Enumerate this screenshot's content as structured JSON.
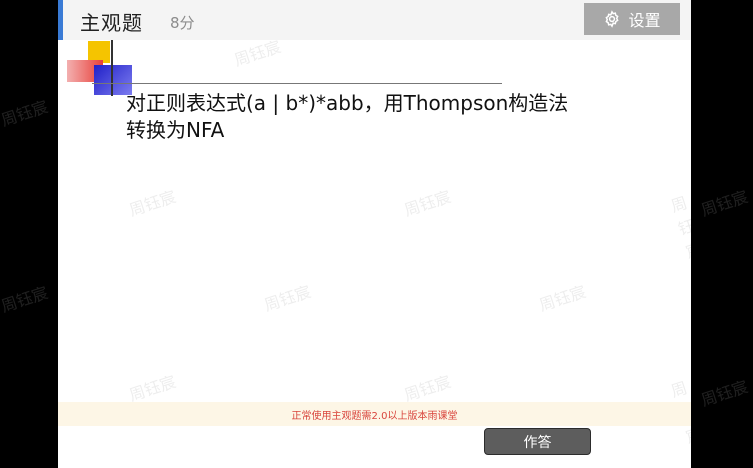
{
  "header": {
    "title": "主观题",
    "score": "8分",
    "settings_label": "设置",
    "settings_icon": "gear-icon",
    "accent_color": "#3a7bd5"
  },
  "slide": {
    "question_line1": "对正则表达式(a | b*)*abb，用Thompson构造法",
    "question_line2": "转换为NFA"
  },
  "watermark": {
    "text": "周钰宸"
  },
  "notice": {
    "text": "正常使用主观题需2.0以上版本雨课堂",
    "color": "#d9453d"
  },
  "actions": {
    "answer_label": "作答"
  }
}
